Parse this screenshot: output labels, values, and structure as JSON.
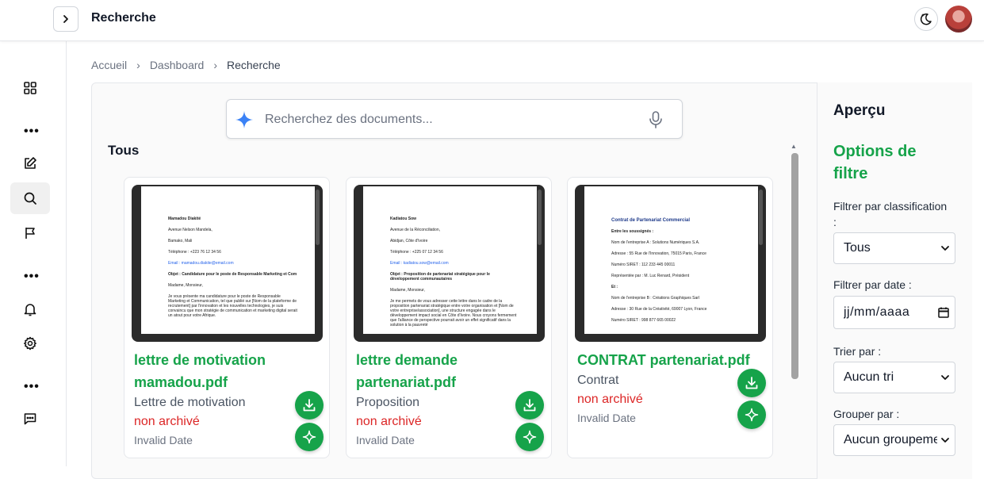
{
  "header": {
    "title": "Recherche"
  },
  "breadcrumb": [
    "Accueil",
    "Dashboard",
    "Recherche"
  ],
  "search": {
    "placeholder": "Recherchez des documents..."
  },
  "section_title": "Tous",
  "documents": [
    {
      "title": "lettre de motivation mamadou.pdf",
      "type": "Lettre de motivation",
      "status": "non archivé",
      "date": "Invalid Date",
      "preview": [
        "Mamadou Diakité",
        "Avenue Nelson Mandela,",
        "Bamako, Mali",
        "Téléphone : +223 76 12 34 56",
        "Email : mamadou.diakite@email.com",
        "Objet : Candidature pour le poste de Responsable Marketing et Com",
        "Madame, Monsieur,",
        "Je vous présente ma candidature pour le poste de Responsable Marketing et Communication, tel que publié sur [Nom de la plateforme de recrutement] par l'innovation et les nouvelles technologies, je suis convaincu que mon stratégie de communication et marketing digital serait un atout pour votre Afrique."
      ]
    },
    {
      "title": "lettre demande partenariat.pdf",
      "type": "Proposition",
      "status": "non archivé",
      "date": "Invalid Date",
      "preview": [
        "Kadiatou Sow",
        "Avenue de la Réconciliation,",
        "Abidjan, Côte d'Ivoire",
        "Téléphone : +225 07 12 34 56",
        "Email : kadiatou.sow@email.com",
        "Objet : Proposition de partenariat stratégique pour le développement communautaires",
        "Madame, Monsieur,",
        "Je me permets de vous adresser cette lettre dans le cadre de la proposition partenariat stratégique entre votre organisation et [Nom de votre entreprise/association], une structure engagée dans le développement impact social en Côte d'Ivoire. Nous croyons fermement que l'alliance de perspective pourrait avoir un effet significatif dans la solution à la pauvreté"
      ]
    },
    {
      "title": "CONTRAT partenariat.pdf",
      "type": "Contrat",
      "status": "non archivé",
      "date": "Invalid Date",
      "preview": [
        "Contrat de Partenariat Commercial",
        "Entre les soussignés :",
        "Nom de l'entreprise A : Solutions Numériques S.A.",
        "Adresse : 55 Rue de l'Innovation, 75015 Paris, France",
        "Numéro SIRET : 112 233 445 00011",
        "Représentée par : M. Luc Renard, Président",
        "Et :",
        "Nom de l'entreprise B : Créations Graphiques Sarl",
        "Adresse : 30 Rue de la Créativité, 69007 Lyon, France",
        "Numéro SIRET : 998 877 665 00022"
      ]
    }
  ],
  "aside": {
    "title": "Aperçu",
    "subtitle": "Options de filtre",
    "classification_label": "Filtrer par classification :",
    "classification_value": "Tous",
    "date_label": "Filtrer par date :",
    "date_placeholder": "jj/mm/aaaa",
    "sort_label": "Trier par :",
    "sort_value": "Aucun tri",
    "group_label": "Grouper par :",
    "group_value": "Aucun groupement"
  },
  "colors": {
    "accent": "#16a34a",
    "status": "#dc2626",
    "spark": "#3b82f6"
  }
}
